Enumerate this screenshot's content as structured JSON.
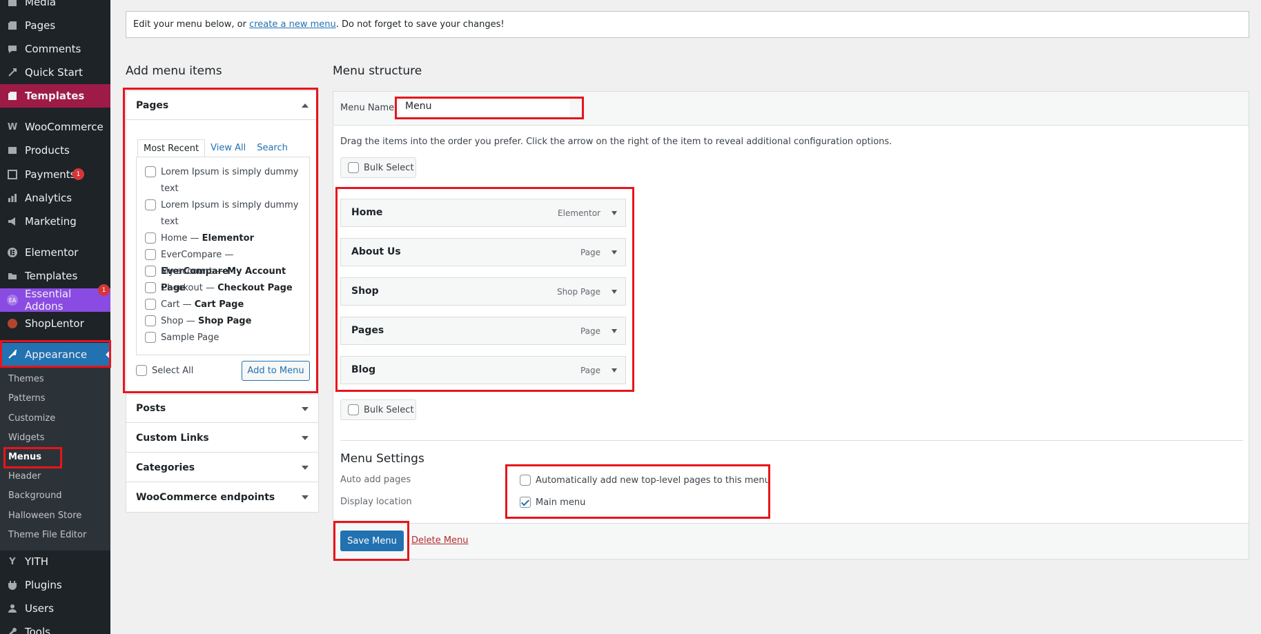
{
  "sidebar": {
    "items": [
      {
        "label": "Media",
        "icon": "media-icon"
      },
      {
        "label": "Pages",
        "icon": "pages-icon"
      },
      {
        "label": "Comments",
        "icon": "comments-icon"
      },
      {
        "label": "Quick Start",
        "icon": "quick-start-icon"
      },
      {
        "label": "Templates",
        "icon": "templates-icon"
      },
      {
        "label": "WooCommerce",
        "icon": "woocommerce-icon"
      },
      {
        "label": "Products",
        "icon": "products-icon"
      },
      {
        "label": "Payments",
        "icon": "payments-icon",
        "badge": "1"
      },
      {
        "label": "Analytics",
        "icon": "analytics-icon"
      },
      {
        "label": "Marketing",
        "icon": "marketing-icon"
      },
      {
        "label": "Elementor",
        "icon": "elementor-icon"
      },
      {
        "label": "Templates",
        "icon": "folder-icon"
      },
      {
        "label": "Essential Addons",
        "icon": "essential-addons-icon",
        "badge": "1"
      },
      {
        "label": "ShopLentor",
        "icon": "shoplentor-icon"
      },
      {
        "label": "Appearance",
        "icon": "appearance-icon"
      },
      {
        "label": "YITH",
        "icon": "yith-icon"
      },
      {
        "label": "Plugins",
        "icon": "plugins-icon"
      },
      {
        "label": "Users",
        "icon": "users-icon"
      },
      {
        "label": "Tools",
        "icon": "tools-icon"
      }
    ],
    "submenu": [
      "Themes",
      "Patterns",
      "Customize",
      "Widgets",
      "Menus",
      "Header",
      "Background",
      "Halloween Store",
      "Theme File Editor"
    ]
  },
  "notice": {
    "before": "Edit your menu below, or ",
    "link": "create a new menu",
    "after": ". Do not forget to save your changes!"
  },
  "add_menu_items": {
    "heading": "Add menu items",
    "pages_title": "Pages",
    "tabs": [
      "Most Recent",
      "View All",
      "Search"
    ],
    "pages": [
      {
        "title": "Lorem Ipsum is simply dummy text",
        "state": ""
      },
      {
        "title": "Lorem Ipsum is simply dummy text",
        "state": ""
      },
      {
        "title": "Home",
        "state": "Elementor"
      },
      {
        "title": "EverCompare",
        "state": "EverCompare"
      },
      {
        "title": "My account",
        "state": "My Account Page"
      },
      {
        "title": "Checkout",
        "state": "Checkout Page"
      },
      {
        "title": "Cart",
        "state": "Cart Page"
      },
      {
        "title": "Shop",
        "state": "Shop Page"
      },
      {
        "title": "Sample Page",
        "state": ""
      }
    ],
    "select_all": "Select All",
    "add_to_menu": "Add to Menu",
    "sections": [
      "Posts",
      "Custom Links",
      "Categories",
      "WooCommerce endpoints"
    ]
  },
  "menu_structure": {
    "heading": "Menu structure",
    "menu_name_label": "Menu Name",
    "menu_name_value": "Menu",
    "instructions": "Drag the items into the order you prefer. Click the arrow on the right of the item to reveal additional configuration options.",
    "bulk_select": "Bulk Select",
    "items": [
      {
        "title": "Home",
        "type": "Elementor"
      },
      {
        "title": "About Us",
        "type": "Page"
      },
      {
        "title": "Shop",
        "type": "Shop Page"
      },
      {
        "title": "Pages",
        "type": "Page"
      },
      {
        "title": "Blog",
        "type": "Page"
      }
    ],
    "settings_heading": "Menu Settings",
    "auto_add_label": "Auto add pages",
    "auto_add_option": "Automatically add new top-level pages to this menu",
    "display_location_label": "Display location",
    "display_location_option": "Main menu",
    "save_menu": "Save Menu",
    "delete_menu": "Delete Menu"
  },
  "colors": {
    "accent": "#2271b1",
    "highlight": "#e8141c",
    "sidebar": "#1d2327"
  }
}
